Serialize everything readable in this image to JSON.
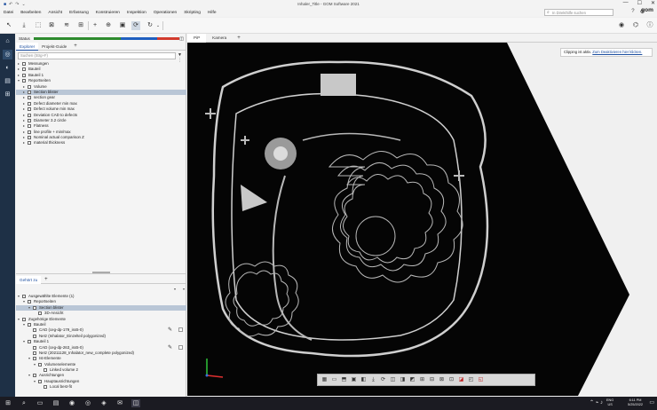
{
  "window": {
    "title": "Inhaler_Title - GOM Software 2021",
    "quick_access": [
      "↶",
      "↷",
      "⌄"
    ],
    "controls": [
      "—",
      "☐",
      "✕"
    ]
  },
  "menu": {
    "items": [
      "Datei",
      "Bearbeiten",
      "Ansicht",
      "Erfassung",
      "Konstruieren",
      "Inspektion",
      "Operationen",
      "Skripting",
      "Hilfe"
    ],
    "search_placeholder": "In Direkthilfe suchen",
    "logo": "gom"
  },
  "toolbar": {
    "icons": [
      "cursor-icon",
      "download-icon",
      "select-icon",
      "trim-icon",
      "layers-icon",
      "plus-icon",
      "target-icon",
      "camera-icon",
      "refresh-icon",
      "reload-icon"
    ]
  },
  "left_panel": {
    "status_label": "Status",
    "status_colors": [
      "#2e8b2e",
      "#1f5fbf",
      "#d23b2e"
    ],
    "tabs": [
      "Explorer",
      "Projekt-Guide"
    ],
    "tab_add": "+",
    "filter_placeholder": "Suchen (Strg+F)",
    "tree": [
      {
        "label": "Messungen",
        "level": 1,
        "twisty": "▸"
      },
      {
        "label": "Bauteil",
        "level": 1,
        "twisty": "▸"
      },
      {
        "label": "Bauteil 1",
        "level": 1,
        "twisty": "▸"
      },
      {
        "label": "Reportseiten",
        "level": 1,
        "twisty": "▾"
      },
      {
        "label": "Volume",
        "level": 2,
        "twisty": "▸"
      },
      {
        "label": "Section blister",
        "level": 2,
        "twisty": "▸",
        "selected": true
      },
      {
        "label": "section gear",
        "level": 2,
        "twisty": "▸"
      },
      {
        "label": "Defect diameter min max",
        "level": 2,
        "twisty": "▸"
      },
      {
        "label": "Defect volume min max",
        "level": 2,
        "twisty": "▸"
      },
      {
        "label": "Deviation CAD to defects",
        "level": 2,
        "twisty": "▸"
      },
      {
        "label": "Diameter 3.2 circle",
        "level": 2,
        "twisty": "▸"
      },
      {
        "label": "Flatness",
        "level": 2,
        "twisty": "▸"
      },
      {
        "label": "line profile + min/max",
        "level": 2,
        "twisty": "▸"
      },
      {
        "label": "Nominal actual comparison Z",
        "level": 2,
        "twisty": "▸"
      },
      {
        "label": "material thickness",
        "level": 2,
        "twisty": "▸"
      }
    ]
  },
  "lower_panel": {
    "tab": "Gehört zu",
    "tab_add": "+",
    "tree": [
      {
        "label": "Ausgewählte Elemente (1)",
        "level": 1,
        "twisty": "▾"
      },
      {
        "label": "Reportseiten",
        "level": 2,
        "twisty": "▾"
      },
      {
        "label": "Section blister",
        "level": 3,
        "twisty": "▾",
        "selected": true
      },
      {
        "label": "3D-Ansicht",
        "level": 4,
        "twisty": ""
      },
      {
        "label": "Zugehörige Elemente",
        "level": 1,
        "twisty": "▾"
      },
      {
        "label": "Bauteil",
        "level": 2,
        "twisty": "▾"
      },
      {
        "label": "CAD (ceg-dp-179_iss5-0)",
        "level": 3,
        "twisty": "",
        "pen": true
      },
      {
        "label": "Netz (Inhalator_Einzelteil polygonized)",
        "level": 3,
        "twisty": ""
      },
      {
        "label": "Bauteil 1",
        "level": 2,
        "twisty": "▾"
      },
      {
        "label": "CAD (ceg-dp-263_iss5-0)",
        "level": 3,
        "twisty": "",
        "pen": true
      },
      {
        "label": "Netz (20211128_Inhalator_new_complete polygonized)",
        "level": 3,
        "twisty": ""
      },
      {
        "label": "Ist-Elemente",
        "level": 3,
        "twisty": "▾"
      },
      {
        "label": "Volumenelemente",
        "level": 4,
        "twisty": "▾"
      },
      {
        "label": "Linked volume 2",
        "level": 5,
        "twisty": ""
      },
      {
        "label": "Ausrichtungen",
        "level": 3,
        "twisty": "▾"
      },
      {
        "label": "Hauptausrichtungen",
        "level": 4,
        "twisty": "▾"
      },
      {
        "label": "Local best-fit",
        "level": 5,
        "twisty": ""
      }
    ]
  },
  "view": {
    "tabs": [
      "PiP",
      "Kamera"
    ],
    "tab_add": "+",
    "notice_text": "Clipping ist aktiv.",
    "notice_link": "Zum Deaktivieren hier klicken."
  },
  "bottom_tools": [
    "▦",
    "▭",
    "⬒",
    "▣",
    "◧",
    "⤓",
    "⟳",
    "◫",
    "◨",
    "◩",
    "⊞",
    "⊟",
    "⊠",
    "⊡",
    "◪",
    "◰",
    "◱"
  ],
  "taskbar": {
    "apps": [
      "⊞",
      "⌕",
      "▭",
      "▤",
      "◉",
      "◎",
      "◈",
      "✉",
      "◫"
    ],
    "lang": "ENG\nUS",
    "time": "6:11 PM",
    "date": "5/25/2022"
  }
}
